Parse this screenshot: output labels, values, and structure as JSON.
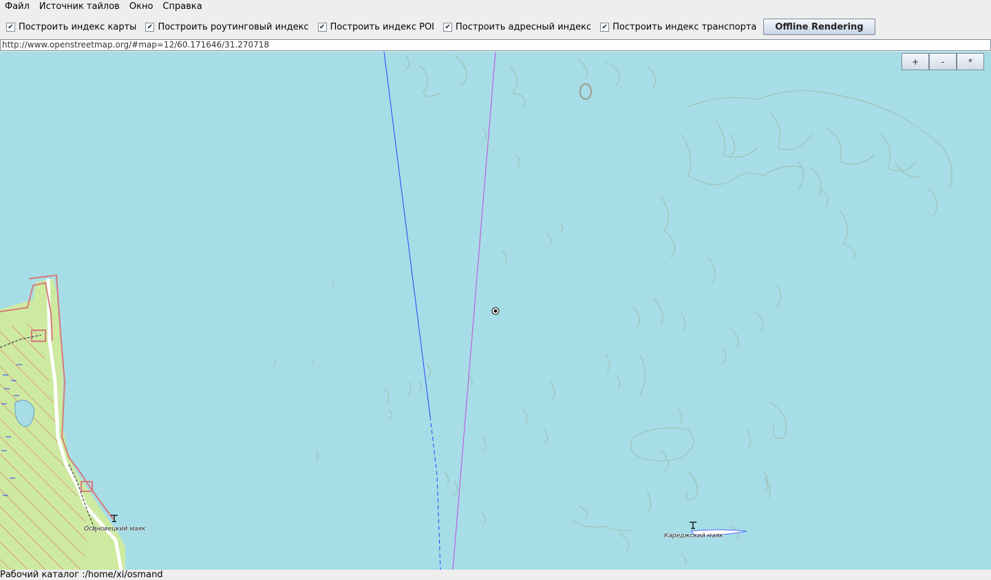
{
  "menubar": {
    "items": [
      "Файл",
      "Источник тайлов",
      "Окно",
      "Справка"
    ]
  },
  "toolbar": {
    "checkboxes": [
      {
        "label": "Построить индекс карты",
        "checked": true
      },
      {
        "label": "Построить роутинговый индекс",
        "checked": true
      },
      {
        "label": "Построить индекс POI",
        "checked": true
      },
      {
        "label": "Построить адресный индекс",
        "checked": true
      },
      {
        "label": "Построить индекс транспорта",
        "checked": true
      }
    ],
    "check_glyph": "✔",
    "offline_button": "Offline Rendering"
  },
  "url": {
    "value": "http://www.openstreetmap.org/#map=12/60.171646/31.270718"
  },
  "map": {
    "zoom_in": "+",
    "zoom_out": "-",
    "zoom_reset": "*",
    "labels": {
      "osinovets": "Осиновецкий маяк",
      "karedzh": "Кареджский маяк"
    },
    "icons": {
      "lighthouse": "lighthouse-icon",
      "center": "map-center-marker-icon"
    },
    "colors": {
      "water": "#a6dde6",
      "land": "#cdeaa0",
      "forest_hatch": "#e06666",
      "boundary": "#d87a7a",
      "contour": "#9fb8a8",
      "blue_line": "#2a40ff",
      "magenta_line": "#c060e0"
    }
  },
  "status": {
    "text": "Рабочий каталог :/home/xi/osmand"
  }
}
